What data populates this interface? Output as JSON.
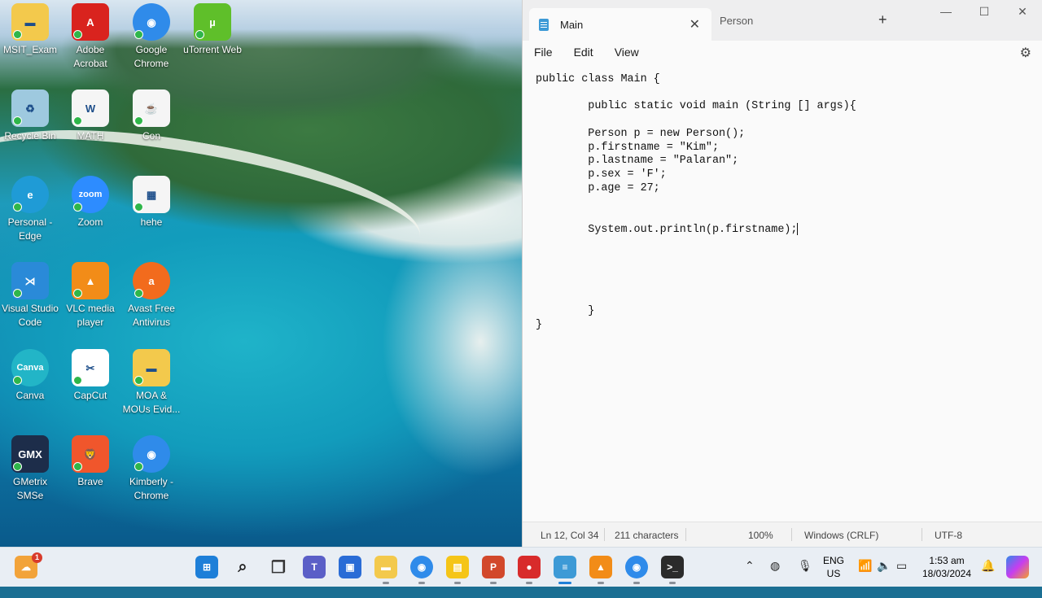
{
  "desktop": {
    "icons": [
      {
        "label": "MSIT_Exam",
        "icon": "folder-icon",
        "color": "#f3c94c"
      },
      {
        "label": "Adobe Acrobat",
        "icon": "acrobat-icon",
        "color": "#d9231e"
      },
      {
        "label": "Google Chrome",
        "icon": "chrome-icon",
        "color": "#2f8bea"
      },
      {
        "label": "uTorrent Web",
        "icon": "utorrent-icon",
        "color": "#5fbf2a"
      },
      {
        "label": "Recycle Bin",
        "icon": "recycle-bin-icon",
        "color": "#9ec9df"
      },
      {
        "label": "MATH",
        "icon": "word-doc-icon",
        "color": "#f5f5f5"
      },
      {
        "label": "Con",
        "icon": "java-file-icon",
        "color": "#f5f5f5"
      },
      {
        "label": "Personal - Edge",
        "icon": "edge-icon",
        "color": "#1f9bd6"
      },
      {
        "label": "Zoom",
        "icon": "zoom-icon",
        "color": "#2d8cff"
      },
      {
        "label": "hehe",
        "icon": "image-file-icon",
        "color": "#f5f5f5"
      },
      {
        "label": "Visual Studio Code",
        "icon": "vscode-icon",
        "color": "#2a8ad8"
      },
      {
        "label": "VLC media player",
        "icon": "vlc-icon",
        "color": "#f28c18"
      },
      {
        "label": "Avast Free Antivirus",
        "icon": "avast-icon",
        "color": "#f26b1d"
      },
      {
        "label": "Canva",
        "icon": "canva-icon",
        "color": "#22b5c7"
      },
      {
        "label": "CapCut",
        "icon": "capcut-icon",
        "color": "#ffffff"
      },
      {
        "label": "MOA & MOUs Evid...",
        "icon": "folder-icon",
        "color": "#f3c94c"
      },
      {
        "label": "GMetrix SMSe",
        "icon": "gmetrix-icon",
        "color": "#1d2d4a"
      },
      {
        "label": "Brave",
        "icon": "brave-icon",
        "color": "#f0562c"
      },
      {
        "label": "Kimberly - Chrome",
        "icon": "chrome-profile-icon",
        "color": "#2f8bea"
      }
    ]
  },
  "notepad": {
    "tabs": [
      {
        "label": "Main",
        "active": true
      },
      {
        "label": "Person",
        "active": false
      }
    ],
    "new_tab": "+",
    "menu": [
      "File",
      "Edit",
      "View"
    ],
    "code": "public class Main {\n\n        public static void main (String [] args){\n\n        Person p = new Person();\n        p.firstname = \"Kim\";\n        p.lastname = \"Palaran\";\n        p.sex = 'F';\n        p.age = 27;\n\n\n        System.out.println(p.firstname);",
    "code_tail": "\n\n\n\n\n\n        }\n}",
    "status": {
      "position": "Ln 12, Col 34",
      "characters": "211 characters",
      "zoom": "100%",
      "line_endings": "Windows (CRLF)",
      "encoding": "UTF-8"
    }
  },
  "taskbar": {
    "weather_badge": "1",
    "apps": [
      {
        "icon": "start-icon",
        "color": "#1e7fd8"
      },
      {
        "icon": "search-icon",
        "color": "#222222"
      },
      {
        "icon": "task-view-icon",
        "color": "#333333"
      },
      {
        "icon": "teams-icon",
        "color": "#5b5fc7"
      },
      {
        "icon": "store-icon",
        "color": "#2a6cd6"
      },
      {
        "icon": "file-explorer-icon",
        "color": "#f3c94c"
      },
      {
        "icon": "chrome-icon",
        "color": "#2f8bea"
      },
      {
        "icon": "sticky-notes-icon",
        "color": "#f5c518"
      },
      {
        "icon": "powerpoint-icon",
        "color": "#d2482b"
      },
      {
        "icon": "screen-recorder-icon",
        "color": "#d82b2b"
      },
      {
        "icon": "notepad-icon",
        "color": "#3d9ad6"
      },
      {
        "icon": "vlc-icon",
        "color": "#f28c18"
      },
      {
        "icon": "chrome-profile-icon",
        "color": "#2f8bea"
      },
      {
        "icon": "terminal-icon",
        "color": "#2b2b2b"
      }
    ],
    "language": {
      "line1": "ENG",
      "line2": "US"
    },
    "time": "1:53 am",
    "date": "18/03/2024"
  }
}
